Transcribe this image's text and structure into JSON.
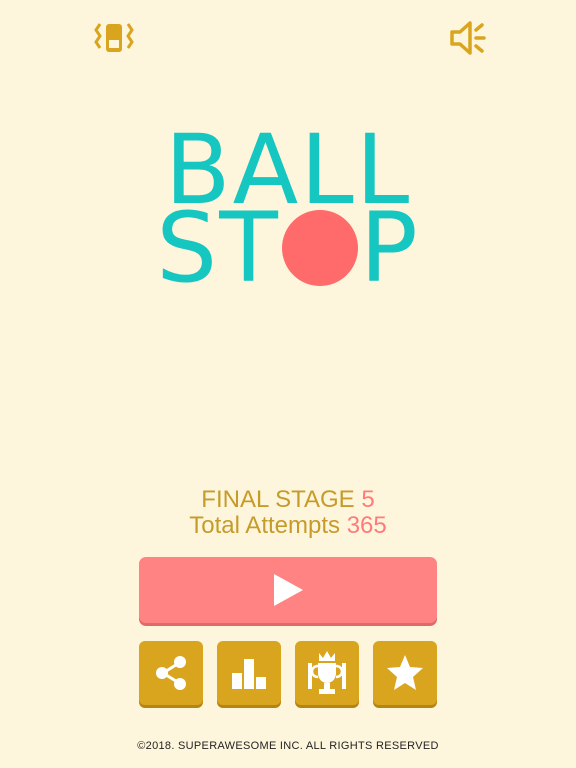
{
  "header": {
    "vibration_icon": "vibration-icon",
    "sound_icon": "sound-on-icon"
  },
  "logo": {
    "line1": "BALL",
    "line2_left": "ST",
    "line2_right": "P"
  },
  "stats": {
    "stage_label": "FINAL STAGE",
    "stage_value": "5",
    "attempts_label": "Total Attempts",
    "attempts_value": "365"
  },
  "buttons": {
    "play_icon": "play-icon",
    "share_icon": "share-icon",
    "leaderboard_icon": "leaderboard-icon",
    "achievements_icon": "trophy-icon",
    "rate_icon": "star-icon"
  },
  "footer": {
    "copyright": "©2018. SUPERAWESOME INC. ALL RIGHTS RESERVED"
  },
  "colors": {
    "background": "#fef6dc",
    "logo": "#16c6c0",
    "ball": "#ff6a6a",
    "gold": "#d9a51e",
    "play": "#ff8383"
  }
}
